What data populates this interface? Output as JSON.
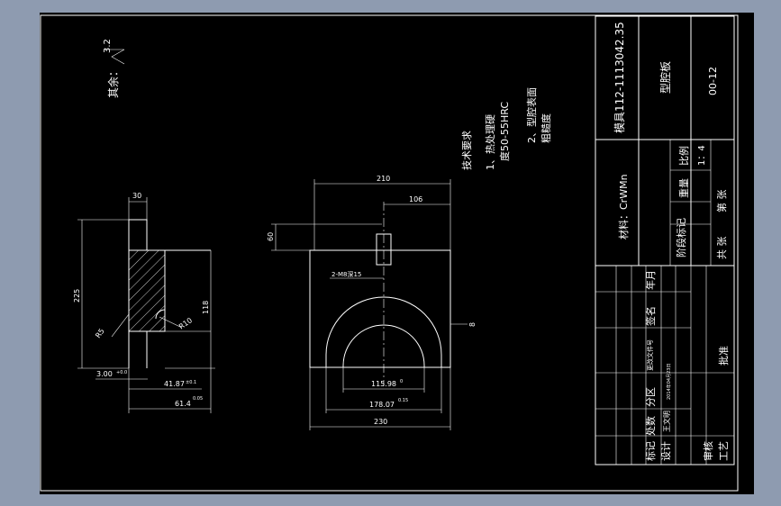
{
  "surface_finish": {
    "prefix": "其余：",
    "value": "3.2"
  },
  "tech_req": {
    "title": "技术要求",
    "line1": "1、热处理硬",
    "line2": "度50-55HRC",
    "line3": "2、型腔表面",
    "line4": "粗糙度"
  },
  "side_view_dims": {
    "top_width": "30",
    "overall_height": "225",
    "right_height": "118",
    "radius_r10": "R10",
    "radius_r5": "R5",
    "dim_3": "3.00",
    "dim_3_tol": "+0.0",
    "dim_41": "41.87",
    "dim_41_tol": "±0.1",
    "dim_61": "61.4",
    "dim_61_tol": "0.05"
  },
  "front_view_dims": {
    "overall_top": "210",
    "center_offset": "106",
    "height_60": "60",
    "hole": "2-M8深15",
    "right_gap": "8",
    "inner_width": "115.98",
    "inner_tol": "0",
    "outer_width": "178.07",
    "outer_tol": "0.15",
    "bottom_width": "230"
  },
  "title_block": {
    "drawing_no": "模具112-1113042.35",
    "part_name": "型腔板",
    "code": "00-12",
    "material": "材料：CrWMn",
    "stage_mark": "阶段标记",
    "weight": "重量",
    "scale_label": "比例",
    "scale_value": "1：4",
    "sheets_total": "共 张",
    "sheet_no": "第 张",
    "approve": "批准",
    "col_mark": "标记",
    "col_count": "处数",
    "col_zone": "分区",
    "col_docno": "更改文件号",
    "col_sign": "签名",
    "col_date": "年月",
    "row_design": "设计",
    "designer": "王文明",
    "design_date": "2014年04月23日",
    "row_check": "审核",
    "row_process": "工艺"
  }
}
